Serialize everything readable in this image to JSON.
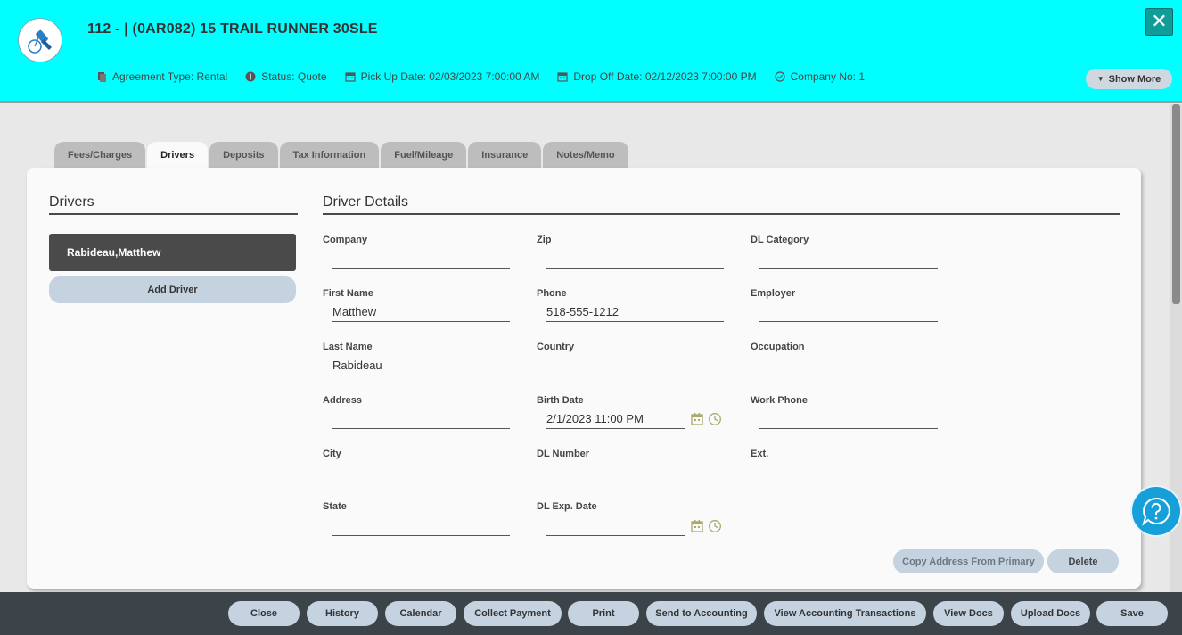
{
  "header": {
    "title": "112 - | (0AR082) 15 TRAIL RUNNER 30SLE",
    "meta": {
      "agreement_type": "Agreement Type: Rental",
      "status": "Status: Quote",
      "pickup": "Pick Up Date: 02/03/2023 7:00:00 AM",
      "dropoff": "Drop Off Date: 02/12/2023 7:00:00 PM",
      "company": "Company No: 1"
    },
    "show_more": "Show More"
  },
  "tabs": [
    "Fees/Charges",
    "Drivers",
    "Deposits",
    "Tax Information",
    "Fuel/Mileage",
    "Insurance",
    "Notes/Memo"
  ],
  "active_tab": "Drivers",
  "drivers": {
    "title": "Drivers",
    "items": [
      "Rabideau,Matthew"
    ],
    "add_label": "Add Driver"
  },
  "details": {
    "title": "Driver Details",
    "company": {
      "label": "Company",
      "value": ""
    },
    "first_name": {
      "label": "First Name",
      "value": "Matthew"
    },
    "last_name": {
      "label": "Last Name",
      "value": "Rabideau"
    },
    "address": {
      "label": "Address",
      "value": ""
    },
    "city": {
      "label": "City",
      "value": ""
    },
    "state": {
      "label": "State",
      "value": ""
    },
    "zip": {
      "label": "Zip",
      "value": ""
    },
    "phone": {
      "label": "Phone",
      "value": "518-555-1212"
    },
    "country": {
      "label": "Country",
      "value": ""
    },
    "birth_date": {
      "label": "Birth Date",
      "value": "2/1/2023 11:00 PM"
    },
    "dl_number": {
      "label": "DL Number",
      "value": ""
    },
    "dl_exp_date": {
      "label": "DL Exp. Date",
      "value": ""
    },
    "dl_category": {
      "label": "DL Category",
      "value": ""
    },
    "employer": {
      "label": "Employer",
      "value": ""
    },
    "occupation": {
      "label": "Occupation",
      "value": ""
    },
    "work_phone": {
      "label": "Work Phone",
      "value": ""
    },
    "ext": {
      "label": "Ext.",
      "value": ""
    },
    "copy_address": "Copy Address From Primary",
    "delete": "Delete"
  },
  "footer": {
    "close": "Close",
    "history": "History",
    "calendar": "Calendar",
    "collect_payment": "Collect Payment",
    "print": "Print",
    "send_to_accounting": "Send to Accounting",
    "view_accounting_transactions": "View Accounting Transactions",
    "view_docs": "View Docs",
    "upload_docs": "Upload Docs",
    "save": "Save"
  },
  "colors": {
    "header_bg": "#00ffff",
    "footer_bg": "#3d4449",
    "button_bg": "#c5d2e0",
    "driver_item_bg": "#4a4a4a",
    "help_bg": "#169fd8"
  },
  "icons": {
    "logo": "keys-icon",
    "close": "close-icon",
    "help": "help-chat-icon"
  }
}
